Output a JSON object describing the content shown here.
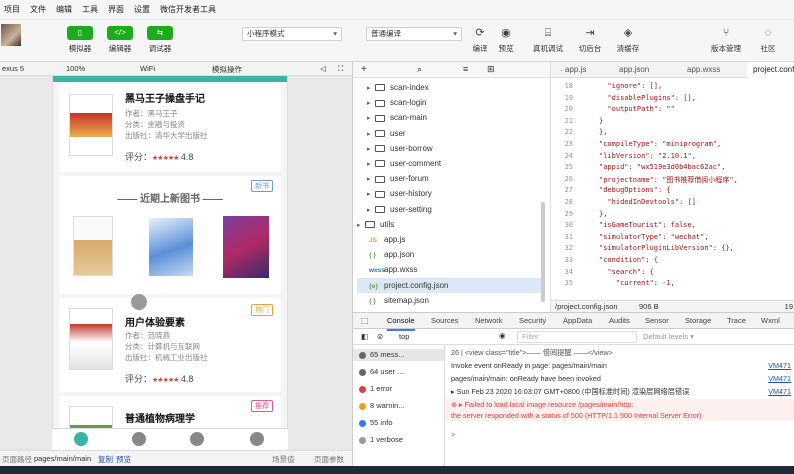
{
  "menu": [
    "项目",
    "文件",
    "编辑",
    "工具",
    "界面",
    "设置",
    "微信开发者工具"
  ],
  "toolbar": {
    "simulator": "模拟器",
    "editor": "编辑器",
    "debugger": "调试器",
    "mode": "小程序模式",
    "compile_mode": "普通编译",
    "compile": "编译",
    "preview": "预览",
    "remote_debug": "真机调试",
    "background": "切后台",
    "clear_cache": "清缓存",
    "version": "版本管理",
    "community": "社区"
  },
  "simbar": {
    "device": "exus 5",
    "zoom": "100%",
    "network": "WiFi",
    "operation": "模拟操作"
  },
  "phone": {
    "book1": {
      "title": "黑马王子操盘手记",
      "author": "作者：黑马王子",
      "category": "分类：金融与投资",
      "publisher": "出版社：清华大学出版社",
      "score_label": "评分：",
      "stars": "★★★★★",
      "score": "4.8"
    },
    "new_books": {
      "heading": "—— 近期上新图书 ——",
      "tag": "新书"
    },
    "book2": {
      "title": "用户体验要素",
      "author": "作者：范晓燕",
      "category": "分类：计算机与互联网",
      "publisher": "出版社：机械工业出版社",
      "score_label": "评分：",
      "stars": "★★★★★",
      "score": "4.8",
      "tag": "热门"
    },
    "book3": {
      "title": "普通植物病理学",
      "tag": "推荐"
    }
  },
  "statusbar": {
    "path_label": "页面路径",
    "path": "pages/main/main",
    "copy": "复制",
    "preview": "预览",
    "scene": "场景值",
    "params": "页面参数"
  },
  "filetree": {
    "items": [
      {
        "name": "scan-index",
        "type": "folder"
      },
      {
        "name": "scan-login",
        "type": "folder"
      },
      {
        "name": "scan-main",
        "type": "folder"
      },
      {
        "name": "user",
        "type": "folder"
      },
      {
        "name": "user-borrow",
        "type": "folder"
      },
      {
        "name": "user-comment",
        "type": "folder"
      },
      {
        "name": "user-forum",
        "type": "folder"
      },
      {
        "name": "user-history",
        "type": "folder"
      },
      {
        "name": "user-setting",
        "type": "folder"
      },
      {
        "name": "utils",
        "type": "folder"
      },
      {
        "name": "app.js",
        "type": "js",
        "icon": "JS"
      },
      {
        "name": "app.json",
        "type": "json",
        "icon": "{ }"
      },
      {
        "name": "app.wxss",
        "type": "wxss",
        "icon": "wxss"
      },
      {
        "name": "project.config.json",
        "type": "json",
        "icon": "{o}"
      },
      {
        "name": "sitemap.json",
        "type": "json",
        "icon": "{ }"
      }
    ]
  },
  "editor": {
    "tabs": [
      "app.js",
      "app.json",
      "app.wxss",
      "project.config.json"
    ],
    "lines": [
      "18",
      "19",
      "20",
      "21",
      "22",
      "23",
      "24",
      "25",
      "26",
      "27",
      "28",
      "29",
      "30",
      "31",
      "32",
      "33",
      "34",
      "35",
      "36",
      "37",
      "38"
    ],
    "code": [
      "  \"ignore\": [],",
      "  \"disablePlugins\": [],",
      "  \"outputPath\": \"\"",
      "}",
      "},",
      "\"compileType\": \"miniprogram\",",
      "\"libVersion\": \"2.10.1\",",
      "\"appid\": \"wx519e3d0b4bac62ac\",",
      "\"projectname\": \"图书推荐借阅小程序\",",
      "\"debugOptions\": {",
      "  \"hidedInDevtools\": []",
      "},",
      "\"isGameTourist\": false,",
      "\"simulatorType\": \"wechat\",",
      "\"simulatorPluginLibVersion\": {},",
      "\"condition\": {",
      "  \"search\": {",
      "    \"current\": -1,"
    ],
    "footer_path": "/project.config.json",
    "footer_size": "906 B",
    "footer_line": "19"
  },
  "devtools": {
    "tabs": [
      "Console",
      "Sources",
      "Network",
      "Security",
      "AppData",
      "Audits",
      "Sensor",
      "Storage",
      "Trace",
      "Wxml"
    ],
    "context": "top",
    "filter_placeholder": "Filter",
    "levels": "Default levels ▾",
    "sidebar": [
      {
        "label": "65 mess...",
        "color": "#666"
      },
      {
        "label": "64 user ...",
        "color": "#666"
      },
      {
        "label": "1 error",
        "color": "#e23c3c"
      },
      {
        "label": "8 warnin...",
        "color": "#e8a318"
      },
      {
        "label": "55 info",
        "color": "#3478f6"
      },
      {
        "label": "1 verbose",
        "color": "#999"
      }
    ],
    "logs": [
      {
        "text": "26 |          <view class=\"title\">—— 借阅提醒 ——</view>",
        "src": ""
      },
      {
        "text": "Invoke event onReady in page: pages/main/main",
        "src": "VM471"
      },
      {
        "text": "pages/main/main: onReady have been invoked",
        "src": "VM471"
      },
      {
        "text": "▸ Sun Feb 23 2020 16:03:07 GMT+0800 (中国标准时间) 渲染层网络层错误",
        "src": "VM471"
      },
      {
        "text": "⊗ ▸ Failed to load local image resource /pages/main/http:",
        "src": ""
      },
      {
        "text": "      the server responded with a status of 500 (HTTP/1.1 500 Internal Server Error)",
        "src": ""
      }
    ],
    "prompt": ">"
  }
}
